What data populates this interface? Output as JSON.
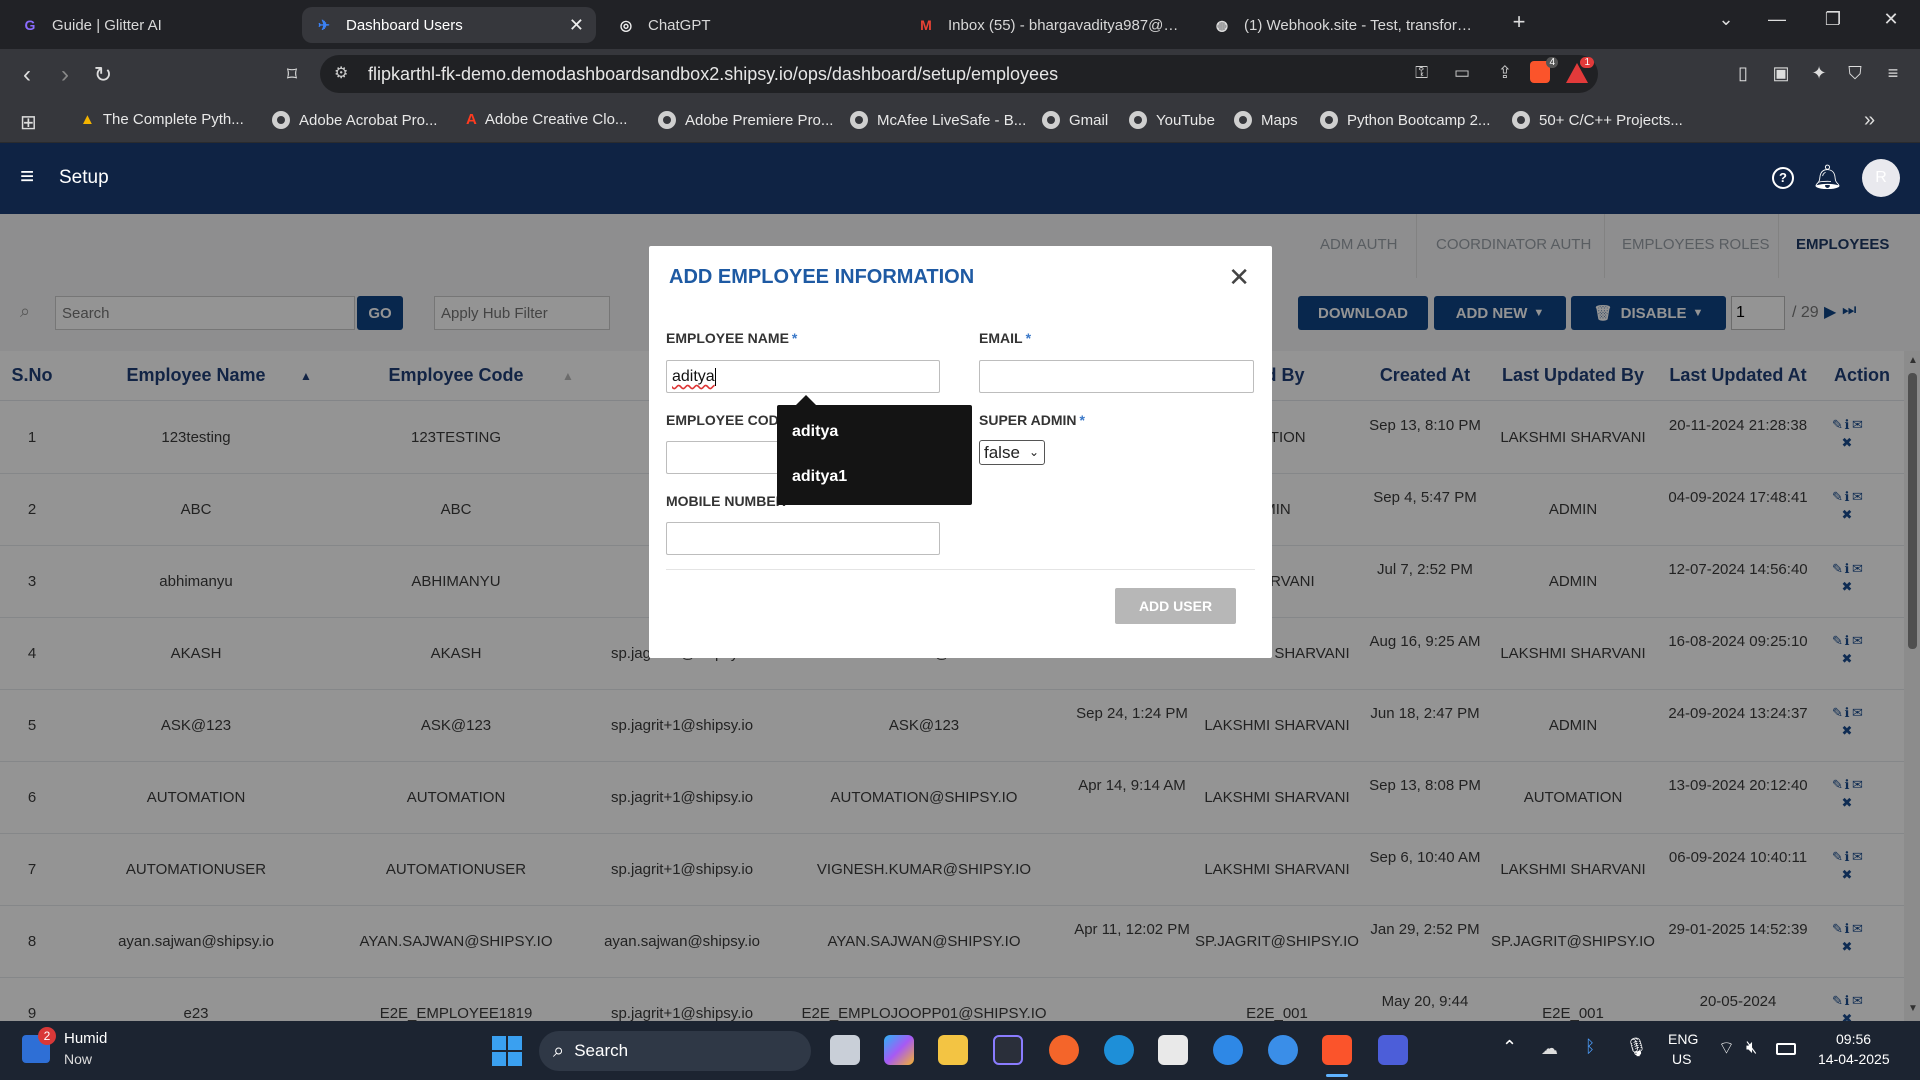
{
  "browser": {
    "tabs": [
      {
        "title": "Guide | Glitter AI"
      },
      {
        "title": "Dashboard Users"
      },
      {
        "title": "ChatGPT"
      },
      {
        "title": "Inbox (55) - bhargavaditya987@gmail.com"
      },
      {
        "title": "(1) Webhook.site - Test, transform and automate"
      }
    ],
    "url": "flipkarthl-fk-demo.demodashboardsandbox2.shipsy.io/ops/dashboard/setup/employees",
    "bookmarks": [
      "The Complete Pyth...",
      "Adobe Acrobat Pro...",
      "Adobe Creative Clo...",
      "Adobe Premiere Pro...",
      "McAfee LiveSafe - B...",
      "Gmail",
      "YouTube",
      "Maps",
      "Python Bootcamp 2...",
      "50+ C/C++ Projects..."
    ],
    "shield_badge": "4",
    "alert_badge": "1"
  },
  "app": {
    "title": "Setup",
    "avatar": "R",
    "subtabs": [
      "ADM AUTH",
      "COORDINATOR AUTH",
      "EMPLOYEES ROLES",
      "EMPLOYEES"
    ],
    "search_placeholder": "Search",
    "go_label": "GO",
    "hub_filter_placeholder": "Apply Hub Filter",
    "download_label": "DOWNLOAD",
    "add_new_label": "ADD NEW",
    "disable_label": "DISABLE",
    "page_current": "1",
    "page_total": "/ 29"
  },
  "table": {
    "headers": [
      "S.No",
      "Employee Name",
      "Employee Code",
      "",
      "",
      "",
      "ted By",
      "Created At",
      "Last Updated By",
      "Last Updated At",
      "Action"
    ],
    "rows": [
      [
        "1",
        "123testing",
        "123TESTING",
        "sp.jag",
        "",
        "",
        "MATION",
        "Sep 13, 8:10 PM",
        "LAKSHMI SHARVANI",
        "20-11-2024 21:28:38"
      ],
      [
        "2",
        "ABC",
        "ABC",
        "sp.jag",
        "",
        "",
        "MIN",
        "Sep 4, 5:47 PM",
        "ADMIN",
        "04-09-2024 17:48:41"
      ],
      [
        "3",
        "abhimanyu",
        "ABHIMANYU",
        "sp.jag",
        "",
        "",
        "SHARVANI",
        "Jul 7, 2:52 PM",
        "ADMIN",
        "12-07-2024 14:56:40"
      ],
      [
        "4",
        "AKASH",
        "AKASH",
        "sp.jagrit+1@shipsy.io",
        "AKASH.KUMAR@SHIPSY.IO",
        "",
        "LAKSHMI SHARVANI",
        "Aug 16, 9:25 AM",
        "LAKSHMI SHARVANI",
        "16-08-2024 09:25:10"
      ],
      [
        "5",
        "ASK@123",
        "ASK@123",
        "sp.jagrit+1@shipsy.io",
        "ASK@123",
        "Sep 24, 1:24 PM",
        "LAKSHMI SHARVANI",
        "Jun 18, 2:47 PM",
        "ADMIN",
        "24-09-2024 13:24:37"
      ],
      [
        "6",
        "AUTOMATION",
        "AUTOMATION",
        "sp.jagrit+1@shipsy.io",
        "AUTOMATION@SHIPSY.IO",
        "Apr 14, 9:14 AM",
        "LAKSHMI SHARVANI",
        "Sep 13, 8:08 PM",
        "AUTOMATION",
        "13-09-2024 20:12:40"
      ],
      [
        "7",
        "AUTOMATIONUSER",
        "AUTOMATIONUSER",
        "sp.jagrit+1@shipsy.io",
        "VIGNESH.KUMAR@SHIPSY.IO",
        "",
        "LAKSHMI SHARVANI",
        "Sep 6, 10:40 AM",
        "LAKSHMI SHARVANI",
        "06-09-2024 10:40:11"
      ],
      [
        "8",
        "ayan.sajwan@shipsy.io",
        "AYAN.SAJWAN@SHIPSY.IO",
        "ayan.sajwan@shipsy.io",
        "AYAN.SAJWAN@SHIPSY.IO",
        "Apr 11, 12:02 PM",
        "SP.JAGRIT@SHIPSY.IO",
        "Jan 29, 2:52 PM",
        "SP.JAGRIT@SHIPSY.IO",
        "29-01-2025 14:52:39"
      ],
      [
        "9",
        "e23",
        "E2E_EMPLOYEE1819",
        "sp.jagrit+1@shipsy.io",
        "E2E_EMPLOJOOPP01@SHIPSY.IO",
        "",
        "E2E_001",
        "May 20, 9:44",
        "E2E_001",
        "20-05-2024"
      ]
    ]
  },
  "modal": {
    "title": "ADD EMPLOYEE INFORMATION",
    "employee_name_label": "EMPLOYEE NAME",
    "employee_name_value": "aditya",
    "email_label": "EMAIL",
    "employee_code_label": "EMPLOYEE CODE",
    "super_admin_label": "SUPER ADMIN",
    "super_admin_value": "false",
    "mobile_label": "MOBILE NUMBER",
    "required_mark": "*",
    "add_user_label": "ADD USER",
    "suggestions": [
      "aditya",
      "aditya1"
    ]
  },
  "taskbar": {
    "weather_title": "Humid",
    "weather_sub": "Now",
    "weather_badge": "2",
    "search_label": "Search",
    "lang_top": "ENG",
    "lang_bottom": "US",
    "time": "09:56",
    "date": "14-04-2025"
  }
}
